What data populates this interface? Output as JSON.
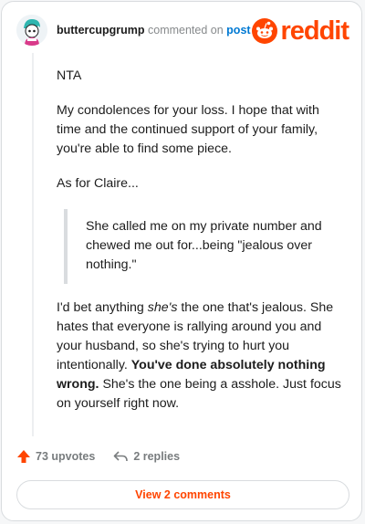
{
  "header": {
    "username": "buttercupgrump",
    "action_text": " commented on ",
    "post_link": "post",
    "logo_text": "reddit",
    "logo_icon": "reddit-snoo-icon",
    "avatar_icon": "avatar-icon",
    "brand_color": "#ff4500"
  },
  "comment": {
    "p1": "NTA",
    "p2": "My condolences for your loss. I hope that with time and the continued support of your family, you're able to find some piece.",
    "p3": "As for Claire...",
    "quote": "She called me on my private number and chewed me out for...being \"jealous over nothing.\"",
    "p4_a": "I'd bet anything ",
    "p4_em": "she's",
    "p4_b": " the one that's jealous. She hates that everyone is rallying around you and your husband, so she's trying to hurt you intentionally. ",
    "p4_strong": "You've done absolutely nothing wrong.",
    "p4_c": " She's the one being a asshole. Just focus on yourself right now."
  },
  "footer": {
    "upvotes_label": "73 upvotes",
    "upvote_icon": "upvote-arrow-icon",
    "replies_label": "2 replies",
    "reply_icon": "reply-icon"
  },
  "view_comments_label": "View 2 comments"
}
